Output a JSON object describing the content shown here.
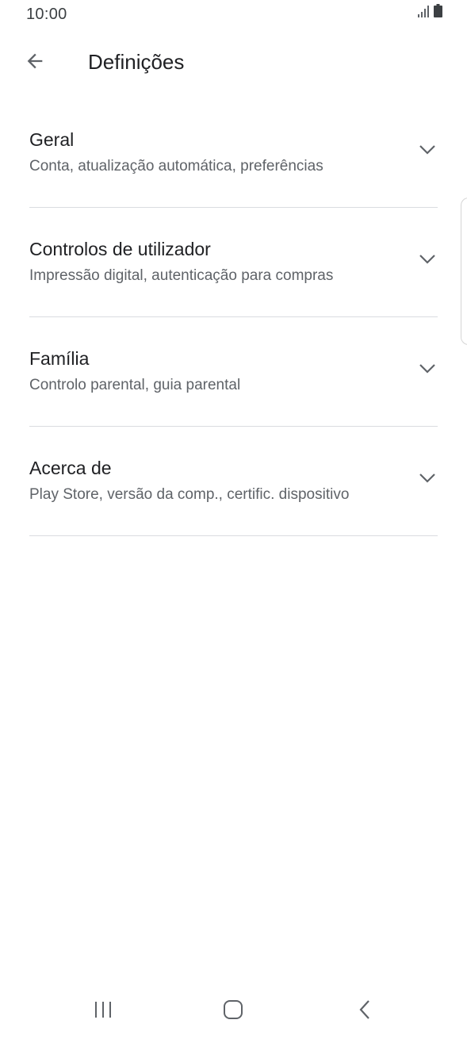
{
  "status_bar": {
    "time": "10:00",
    "icons": [
      "signal-icon",
      "battery-icon"
    ]
  },
  "header": {
    "title": "Definições",
    "back_icon": "arrow-back-icon"
  },
  "settings": [
    {
      "title": "Geral",
      "subtitle": "Conta, atualização automática, preferências"
    },
    {
      "title": "Controlos de utilizador",
      "subtitle": "Impressão digital, autenticação para compras"
    },
    {
      "title": "Família",
      "subtitle": "Controlo parental, guia parental"
    },
    {
      "title": "Acerca de",
      "subtitle": "Play Store, versão da comp., certific. dispositivo"
    }
  ],
  "nav_bar": {
    "buttons": [
      "recent-apps-icon",
      "home-icon",
      "back-icon"
    ]
  },
  "colors": {
    "text_primary": "#202124",
    "text_secondary": "#5f6368",
    "divider": "#dadce0"
  }
}
